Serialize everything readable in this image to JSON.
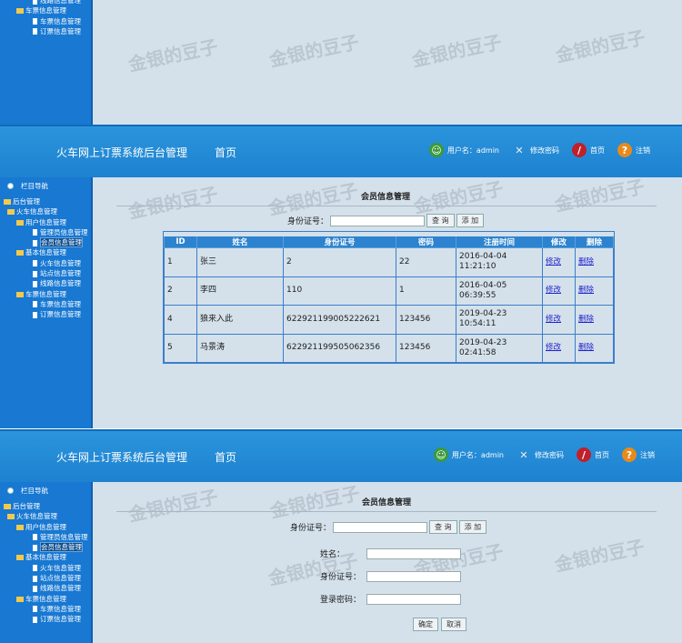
{
  "header": {
    "title": "火车网上订票系统后台管理",
    "home": "首页",
    "user_label": "用户名：admin",
    "change_password": "修改密码",
    "home_link": "首页",
    "logout": "注销"
  },
  "sidebar": {
    "nav_title": "栏目导航",
    "root": "后台管理",
    "train": "火车信息管理",
    "user_group": "用户信息管理",
    "admin_info": "管理员信息管理",
    "member_info": "会员信息管理",
    "basic_group": "基本信息管理",
    "train_info": "火车信息管理",
    "station_info": "站点信息管理",
    "route_info": "线路信息管理",
    "ticket_group": "车票信息管理",
    "ticket_info": "车票信息管理",
    "order_info": "订票信息管理"
  },
  "page": {
    "title": "会员信息管理",
    "search_label": "身份证号：",
    "search_value": "",
    "query": "查 询",
    "add": "添 加"
  },
  "table": {
    "headers": [
      "ID",
      "姓名",
      "身份证号",
      "密码",
      "注册时间",
      "修改",
      "删除"
    ],
    "rows": [
      {
        "id": "1",
        "name": "张三",
        "idcard": "2",
        "pwd": "22",
        "date": "2016-04-04",
        "time": "11:21:10",
        "edit": "修改",
        "del": "删除"
      },
      {
        "id": "2",
        "name": "李四",
        "idcard": "110",
        "pwd": "1",
        "date": "2016-04-05",
        "time": "06:39:55",
        "edit": "修改",
        "del": "删除"
      },
      {
        "id": "4",
        "name": "狼来入此",
        "idcard": "622921199005222621",
        "pwd": "123456",
        "date": "2019-04-23",
        "time": "10:54:11",
        "edit": "修改",
        "del": "删除"
      },
      {
        "id": "5",
        "name": "马景涛",
        "idcard": "622921199505062356",
        "pwd": "123456",
        "date": "2019-04-23",
        "time": "02:41:58",
        "edit": "修改",
        "del": "删除"
      }
    ]
  },
  "form": {
    "name_label": "姓名：",
    "idcard_label": "身份证号：",
    "pwd_label": "登录密码：",
    "confirm": "确定",
    "cancel": "取消"
  },
  "watermark": "金银的豆子"
}
